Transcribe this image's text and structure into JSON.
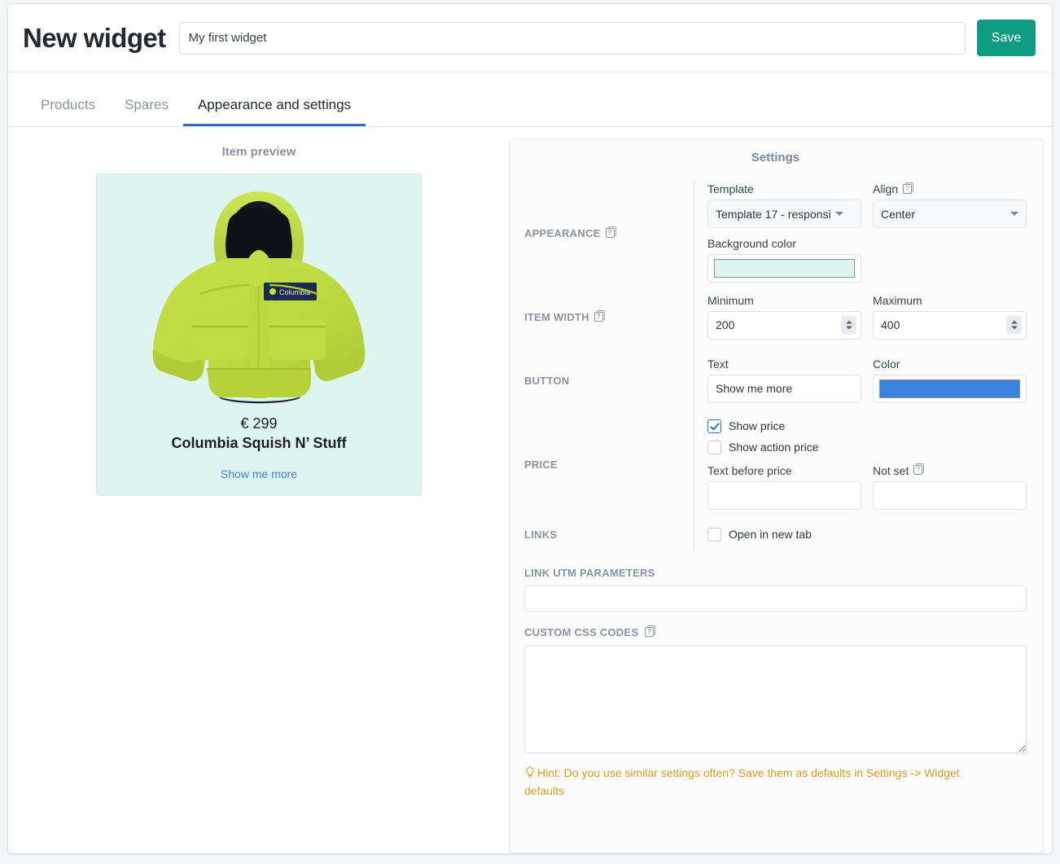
{
  "header": {
    "title": "New widget",
    "name_input_value": "My first widget",
    "name_input_placeholder": "",
    "save_label": "Save",
    "save_color": "#0d9b82"
  },
  "tabs": [
    {
      "label": "Products",
      "active": false
    },
    {
      "label": "Spares",
      "active": false
    },
    {
      "label": "Appearance and settings",
      "active": true
    }
  ],
  "tab_accent_color": "#2d6cb5",
  "preview": {
    "title": "Item preview",
    "background_color": "#ddf5ee",
    "image_alt": "lime green Columbia child puffer jacket with hood",
    "price": "€ 299",
    "product_name": "Columbia Squish N’ Stuff",
    "button_label": "Show me more",
    "link_color": "#4a7ddb"
  },
  "settings": {
    "title": "Settings",
    "appearance": {
      "section_label": "APPEARANCE",
      "help_icon": "help-icon",
      "template_label": "Template",
      "template_value": "Template 17 - responsi",
      "align_label": "Align",
      "align_help_icon": "help-icon",
      "align_value": "Center",
      "background_label": "Background color",
      "background_value": "#ddf5ee"
    },
    "item_width": {
      "section_label": "ITEM WIDTH",
      "help_icon": "help-icon",
      "minimum_label": "Minimum",
      "minimum_value": "200",
      "maximum_label": "Maximum",
      "maximum_value": "400"
    },
    "button": {
      "section_label": "BUTTON",
      "text_label": "Text",
      "text_value": "Show me more",
      "color_label": "Color",
      "color_value": "#3b82e0"
    },
    "price": {
      "section_label": "PRICE",
      "show_price_label": "Show price",
      "show_price_checked": true,
      "show_action_price_label": "Show action price",
      "show_action_price_checked": false,
      "text_before_label": "Text before price",
      "text_before_value": "",
      "not_set_label": "Not set",
      "not_set_help_icon": "help-icon",
      "not_set_value": ""
    },
    "links": {
      "section_label": "LINKS",
      "open_new_tab_label": "Open in new tab",
      "open_new_tab_checked": false
    },
    "utm": {
      "block_label": "LINK UTM PARAMETERS",
      "value": ""
    },
    "custom_css": {
      "block_label": "CUSTOM CSS CODES",
      "help_icon": "help-icon",
      "value": ""
    },
    "hint": {
      "icon": "lightbulb-icon",
      "text": "Hint: Do you use similar settings often? Save them as defaults in Settings -> Widget defaults",
      "color": "#d79a1f"
    }
  }
}
